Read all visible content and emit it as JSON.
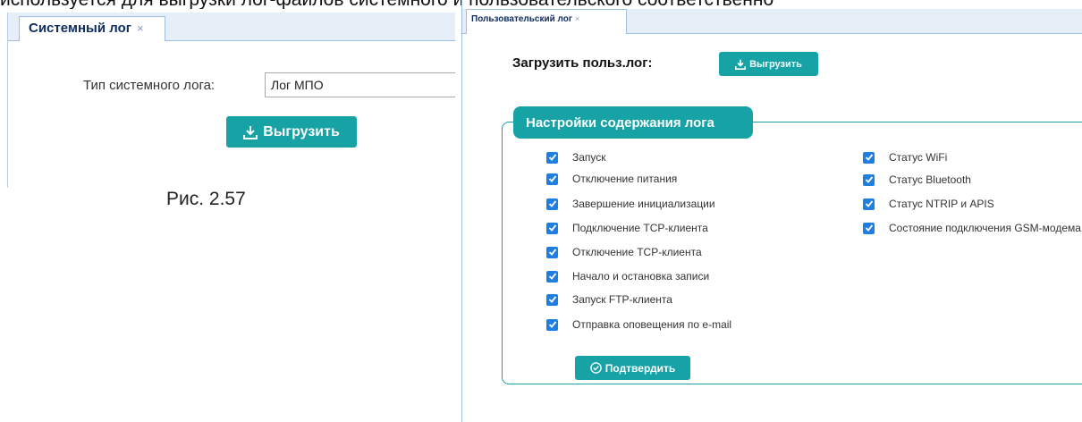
{
  "page_top_text": "используется для выгрузки лог-файлов системного и пользовательского соответственно",
  "system_log": {
    "tab_label": "Системный лог",
    "tab_close": "×",
    "type_label": "Тип системного лога:",
    "type_value": "Лог МПО",
    "export_label": "Выгрузить"
  },
  "figure_caption": "Рис. 2.57",
  "user_log": {
    "tab_label": "Пользовательский лог",
    "tab_close": "×",
    "upload_label": "Загрузить польз.лог:",
    "export_label": "Выгрузить",
    "settings_legend": "Настройки содержания лога",
    "options_left": [
      {
        "label": "Запуск",
        "checked": true
      },
      {
        "label": "Отключение питания",
        "checked": true
      },
      {
        "label": "Завершение инициализации",
        "checked": true
      },
      {
        "label": "Подключение TCP-клиента",
        "checked": true
      },
      {
        "label": "Отключение TCP-клиента",
        "checked": true
      },
      {
        "label": "Начало и остановка записи",
        "checked": true
      },
      {
        "label": "Запуск FTP-клиента",
        "checked": true
      },
      {
        "label": "Отправка оповещения по e-mail",
        "checked": true
      }
    ],
    "options_right": [
      {
        "label": "Статус WiFi",
        "checked": true
      },
      {
        "label": "Статус Bluetooth",
        "checked": true
      },
      {
        "label": "Статус NTRIP и APIS",
        "checked": true
      },
      {
        "label": "Состояние подключения GSM-модема",
        "checked": true
      }
    ],
    "confirm_label": "Подтвердить"
  },
  "colors": {
    "accent_teal": "#17a2a6",
    "checkbox_blue": "#1f7fe0",
    "tab_text": "#0e2d5f",
    "tabbar_bg": "#e6eef8"
  },
  "icons": {
    "export": "download-icon",
    "confirm": "check-circle-icon",
    "checkbox": "checkmark-icon"
  }
}
